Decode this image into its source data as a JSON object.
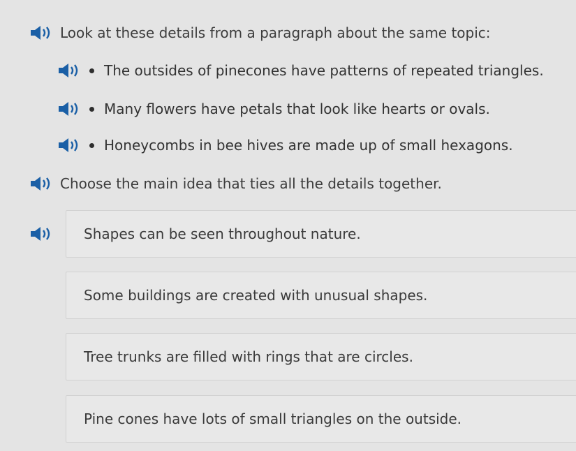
{
  "prompt": {
    "text": "Look at these details from a paragraph about the same topic:"
  },
  "details": [
    {
      "text": "The outsides of pinecones have patterns of repeated triangles."
    },
    {
      "text": "Many flowers have petals that look like hearts or ovals."
    },
    {
      "text": "Honeycombs in bee hives are made up of small hexagons."
    }
  ],
  "question": {
    "text": "Choose the main idea that ties all the details together."
  },
  "choices": [
    {
      "text": "Shapes can be seen throughout nature."
    },
    {
      "text": "Some buildings are created with unusual shapes."
    },
    {
      "text": "Tree trunks are filled with rings that are circles."
    },
    {
      "text": "Pine cones have lots of small triangles on the outside."
    }
  ],
  "colors": {
    "speaker": "#1a5fa6",
    "background": "#e4e4e4",
    "choice_border": "#d2d2d2"
  },
  "icons": {
    "audio": "speaker-icon"
  }
}
